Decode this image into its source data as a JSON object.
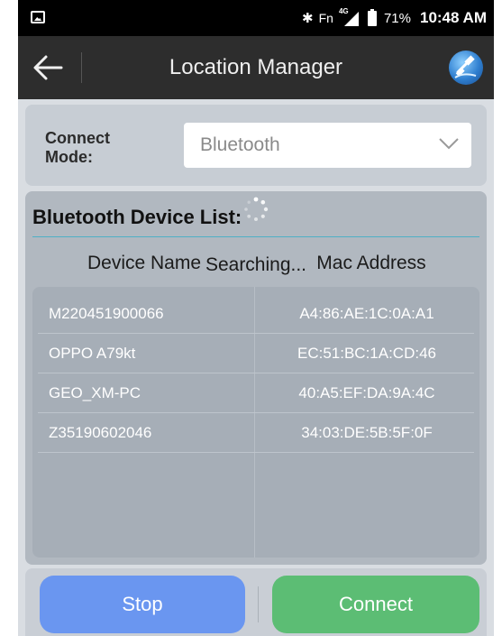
{
  "status_bar": {
    "bluetooth_glyph": "✱",
    "network_label": "Fn",
    "signal_label": "4G",
    "battery": "71%",
    "time": "10:48 AM"
  },
  "app_bar": {
    "title": "Location Manager",
    "back_icon": "arrow-left-icon",
    "app_icon": "satellite-globe-icon"
  },
  "connect_mode": {
    "label": "Connect Mode:",
    "selected": "Bluetooth"
  },
  "device_list": {
    "title": "Bluetooth Device List:",
    "columns": [
      "Device Name",
      "Mac Address"
    ],
    "rows": [
      {
        "name": "M220451900066",
        "mac": "A4:86:AE:1C:0A:A1"
      },
      {
        "name": "OPPO A79kt",
        "mac": "EC:51:BC:1A:CD:46"
      },
      {
        "name": "GEO_XM-PC",
        "mac": "40:A5:EF:DA:9A:4C"
      },
      {
        "name": "Z35190602046",
        "mac": "34:03:DE:5B:5F:0F"
      }
    ],
    "status": "Searching..."
  },
  "buttons": {
    "stop": "Stop",
    "connect": "Connect"
  },
  "colors": {
    "stop": "#6a96f0",
    "connect": "#5cbd74",
    "app_bar": "#2d2d2d"
  }
}
